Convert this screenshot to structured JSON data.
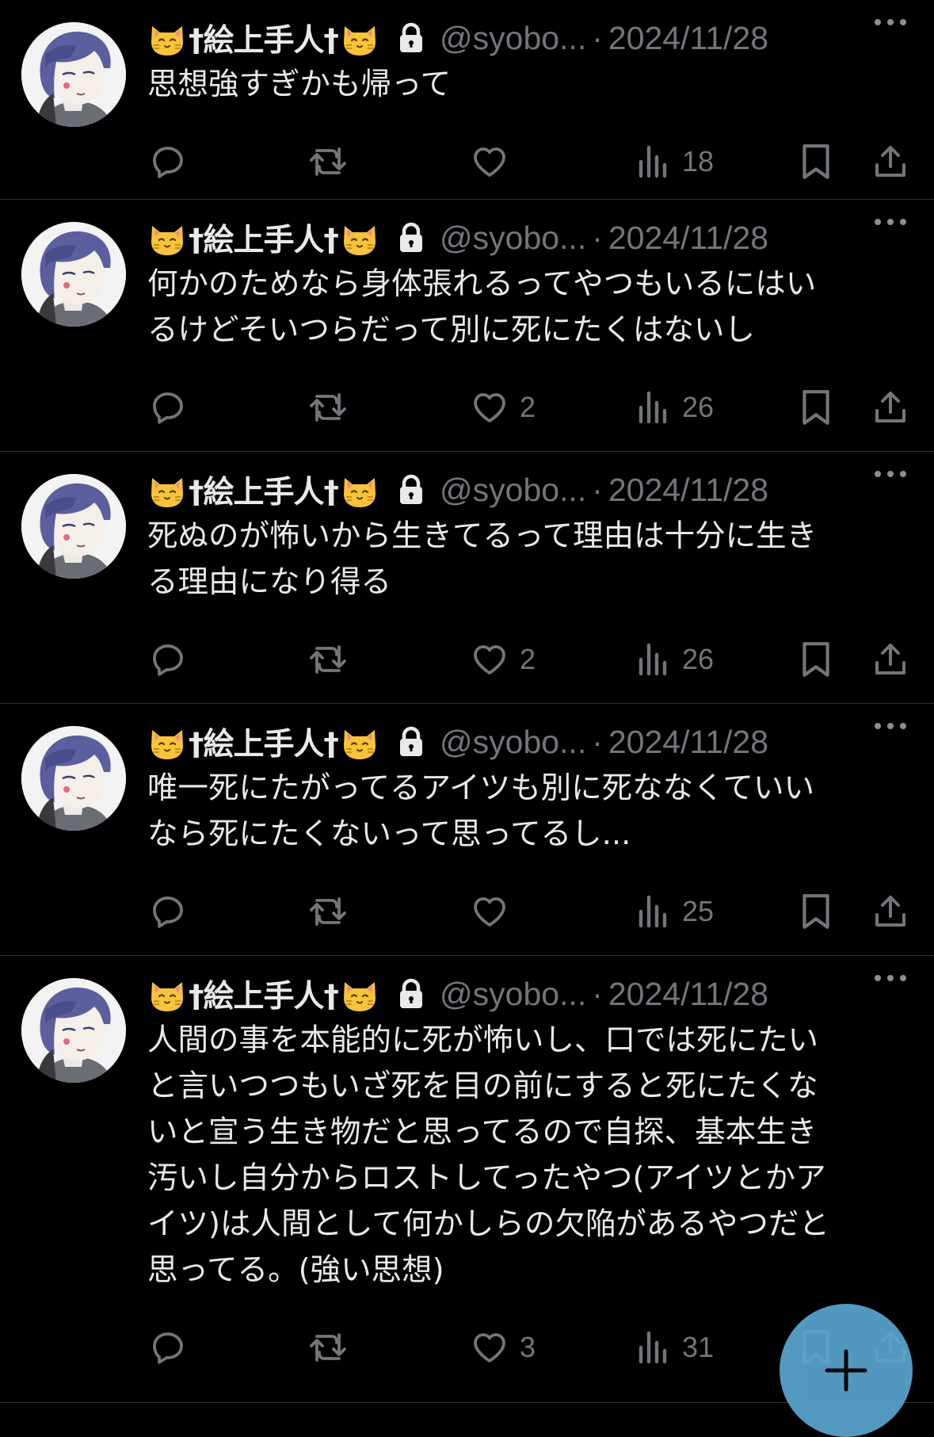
{
  "author": {
    "display_name": "†絵上手人†",
    "handle": "@syobo...",
    "separator": "·"
  },
  "icons": {
    "reply": "reply-bubble-icon",
    "repost": "repost-arrows-icon",
    "like": "heart-icon",
    "views": "bar-chart-icon",
    "bookmark": "bookmark-icon",
    "share": "share-upload-icon",
    "more": "ellipsis-icon",
    "lock": "lock-icon",
    "compose": "plus-icon"
  },
  "colors": {
    "background": "#000000",
    "text": "#e7e9ea",
    "muted": "#71767b",
    "divider": "#2f3336",
    "fab": "#5aa5cf"
  },
  "tweets": [
    {
      "date": "2024/11/28",
      "text": "思想強すぎかも帰って",
      "likes": "",
      "views": "18"
    },
    {
      "date": "2024/11/28",
      "text": "何かのためなら身体張れるってやつもいるにはい\nるけどそいつらだって別に死にたくはないし",
      "likes": "2",
      "views": "26"
    },
    {
      "date": "2024/11/28",
      "text": "死ぬのが怖いから生きてるって理由は十分に生き\nる理由になり得る",
      "likes": "2",
      "views": "26"
    },
    {
      "date": "2024/11/28",
      "text": "唯一死にたがってるアイツも別に死ななくていい\nなら死にたくないって思ってるし...",
      "likes": "",
      "views": "25"
    },
    {
      "date": "2024/11/28",
      "text": "人間の事を本能的に死が怖いし、口では死にたい\nと言いつつもいざ死を目の前にすると死にたくな\nいと宣う生き物だと思ってるので自探、基本生き\n汚いし自分からロストしてったやつ(アイツとかア\nイツ)は人間として何かしらの欠陥があるやつだと\n思ってる。(強い思想)",
      "likes": "3",
      "views": "31"
    }
  ]
}
